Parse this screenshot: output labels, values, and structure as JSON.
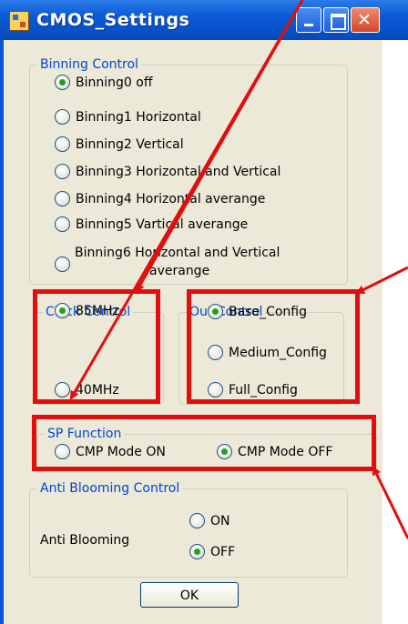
{
  "window": {
    "title": "CMOS_Settings"
  },
  "binning": {
    "title": "Binning Control",
    "options": [
      {
        "label": "Binning0 off",
        "checked": true
      },
      {
        "label": "Binning1 Horizontal",
        "checked": false
      },
      {
        "label": "Binning2 Vertical",
        "checked": false
      },
      {
        "label": "Binning3 Horizontal and Vertical",
        "checked": false
      },
      {
        "label": "Binning4 Horizontal averange",
        "checked": false
      },
      {
        "label": "Binning5 Vartical averange",
        "checked": false
      },
      {
        "label_line1": "Binning6 Horizontal and Vertical",
        "label_line2": "averange",
        "checked": false
      }
    ]
  },
  "clock": {
    "title": "Clock Control",
    "options": [
      {
        "label": "85MHz",
        "checked": true
      },
      {
        "label": "40MHz",
        "checked": false
      }
    ]
  },
  "out": {
    "title": "Out Control",
    "options": [
      {
        "label": "Base_Config",
        "checked": true
      },
      {
        "label": "Medium_Config",
        "checked": false
      },
      {
        "label": "Full_Config",
        "checked": false
      }
    ]
  },
  "sp": {
    "title": "SP Function",
    "options": [
      {
        "label": "CMP Mode ON",
        "checked": false
      },
      {
        "label": "CMP Mode OFF",
        "checked": true
      }
    ]
  },
  "anti": {
    "title": "Anti Blooming Control",
    "label": "Anti Blooming",
    "options": [
      {
        "label": "ON",
        "checked": false
      },
      {
        "label": "OFF",
        "checked": true
      }
    ]
  },
  "ok_label": "OK",
  "colors": {
    "highlight": "#e30d0d",
    "group_title": "#0046d5",
    "radio_dot": "#21a121"
  }
}
